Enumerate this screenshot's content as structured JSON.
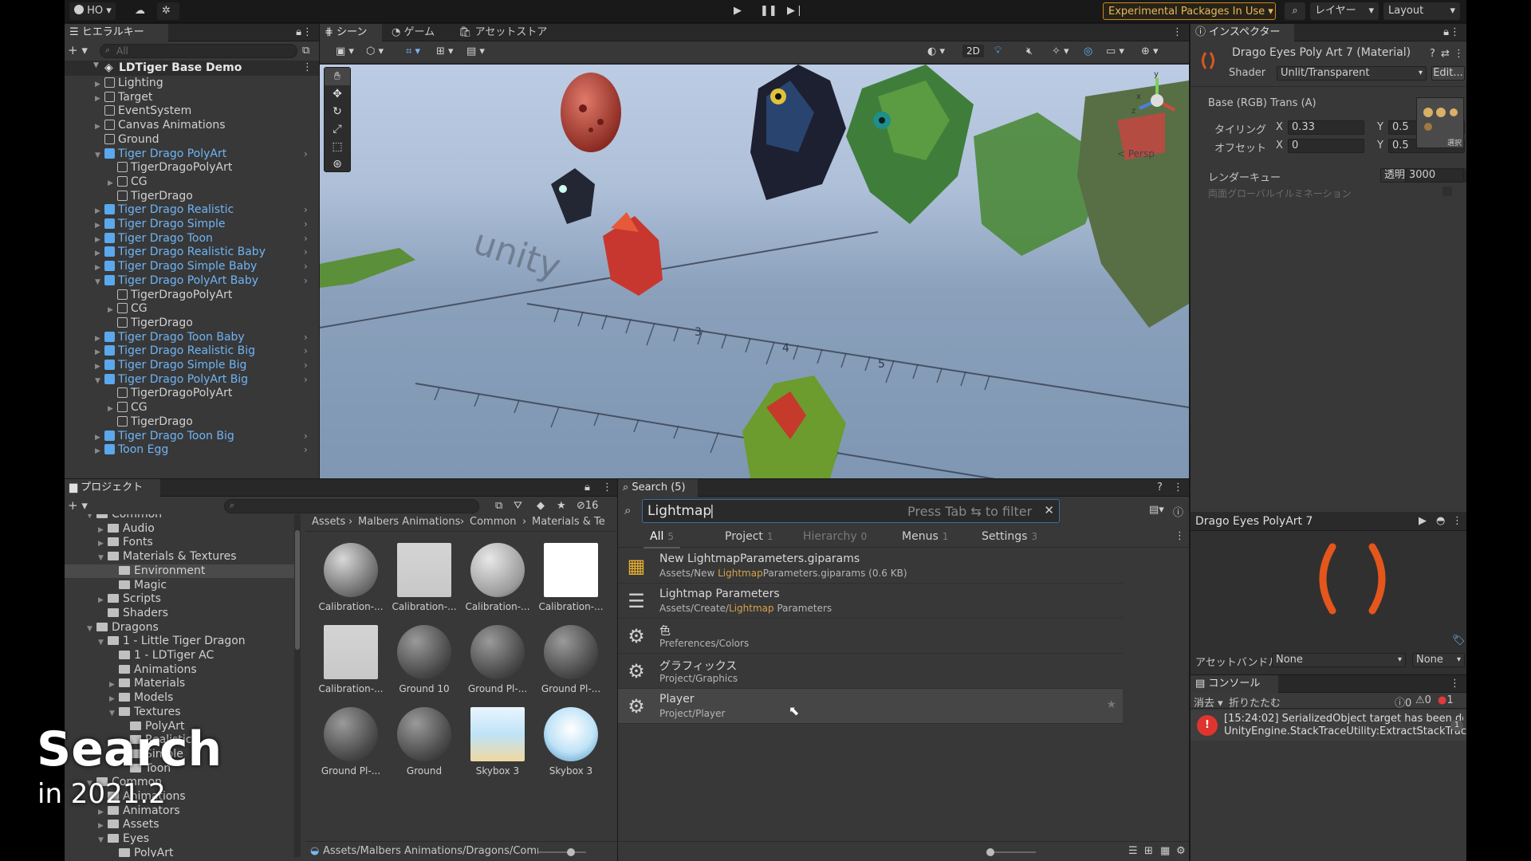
{
  "toolbar": {
    "account": "HO",
    "experimental": "Experimental Packages In Use",
    "layers": "レイヤー",
    "layout": "Layout"
  },
  "hierarchy": {
    "tab": "ヒエラルキー",
    "search_placeholder": "All",
    "scene": "LDTiger Base Demo",
    "items": [
      {
        "label": "Lighting",
        "indent": 1,
        "prefab": false,
        "arrow": "▶"
      },
      {
        "label": "Target",
        "indent": 1,
        "prefab": false,
        "arrow": "▶"
      },
      {
        "label": "EventSystem",
        "indent": 1,
        "prefab": false,
        "arrow": ""
      },
      {
        "label": "Canvas Animations",
        "indent": 1,
        "prefab": false,
        "arrow": "▶"
      },
      {
        "label": "Ground",
        "indent": 1,
        "prefab": false,
        "arrow": ""
      },
      {
        "label": "Tiger Drago PolyArt",
        "indent": 1,
        "prefab": true,
        "arrow": "▼"
      },
      {
        "label": "TigerDragoPolyArt",
        "indent": 2,
        "prefab": false,
        "arrow": ""
      },
      {
        "label": "CG",
        "indent": 2,
        "prefab": false,
        "arrow": "▶"
      },
      {
        "label": "TigerDrago",
        "indent": 2,
        "prefab": false,
        "arrow": ""
      },
      {
        "label": "Tiger Drago Realistic",
        "indent": 1,
        "prefab": true,
        "arrow": "▶"
      },
      {
        "label": "Tiger Drago Simple",
        "indent": 1,
        "prefab": true,
        "arrow": "▶"
      },
      {
        "label": "Tiger Drago Toon",
        "indent": 1,
        "prefab": true,
        "arrow": "▶"
      },
      {
        "label": "Tiger Drago Realistic Baby",
        "indent": 1,
        "prefab": true,
        "arrow": "▶"
      },
      {
        "label": "Tiger Drago Simple Baby",
        "indent": 1,
        "prefab": true,
        "arrow": "▶"
      },
      {
        "label": "Tiger Drago PolyArt Baby",
        "indent": 1,
        "prefab": true,
        "arrow": "▼"
      },
      {
        "label": "TigerDragoPolyArt",
        "indent": 2,
        "prefab": false,
        "arrow": ""
      },
      {
        "label": "CG",
        "indent": 2,
        "prefab": false,
        "arrow": "▶"
      },
      {
        "label": "TigerDrago",
        "indent": 2,
        "prefab": false,
        "arrow": ""
      },
      {
        "label": "Tiger Drago Toon Baby",
        "indent": 1,
        "prefab": true,
        "arrow": "▶"
      },
      {
        "label": "Tiger Drago Realistic Big",
        "indent": 1,
        "prefab": true,
        "arrow": "▶"
      },
      {
        "label": "Tiger Drago Simple Big",
        "indent": 1,
        "prefab": true,
        "arrow": "▶"
      },
      {
        "label": "Tiger Drago PolyArt Big",
        "indent": 1,
        "prefab": true,
        "arrow": "▼"
      },
      {
        "label": "TigerDragoPolyArt",
        "indent": 2,
        "prefab": false,
        "arrow": ""
      },
      {
        "label": "CG",
        "indent": 2,
        "prefab": false,
        "arrow": "▶"
      },
      {
        "label": "TigerDrago",
        "indent": 2,
        "prefab": false,
        "arrow": ""
      },
      {
        "label": "Tiger Drago Toon Big",
        "indent": 1,
        "prefab": true,
        "arrow": "▶"
      },
      {
        "label": "Toon Egg",
        "indent": 1,
        "prefab": true,
        "arrow": "▶"
      }
    ]
  },
  "scene": {
    "tabs": [
      "シーン",
      "ゲーム",
      "アセットストア"
    ],
    "mode_2d": "2D",
    "persp": "< Persp"
  },
  "inspector": {
    "tab": "インスペクター",
    "title": "Drago Eyes Poly Art 7 (Material)",
    "shader_label": "Shader",
    "shader_value": "Unlit/Transparent",
    "edit": "Edit...",
    "base_label": "Base (RGB) Trans (A)",
    "tiling_label": "タイリング",
    "offset_label": "オフセット",
    "tiling_x": "0.33",
    "tiling_y": "0.5",
    "offset_x": "0",
    "offset_y": "0.5",
    "select": "選択",
    "render_queue_label": "レンダーキュー",
    "render_queue_mode": "透明",
    "render_queue_value": "3000",
    "gi_label": "両面グローバルイルミネーション",
    "preview_title": "Drago Eyes PolyArt 7",
    "asset_bundle_label": "アセットバンドル",
    "asset_bundle_value": "None",
    "asset_variant_value": "None"
  },
  "console": {
    "tab": "コンソール",
    "clear": "消去",
    "collapse": "折りたたむ",
    "count_info": "0",
    "count_warn": "0",
    "count_error": "1",
    "message_line1": "[15:24:02] SerializedObject target has been destroyed.",
    "message_line2": "UnityEngine.StackTraceUtility:ExtractStackTrace ()",
    "badge": "1"
  },
  "project": {
    "tab": "プロジェクト",
    "hidden_count": "16",
    "breadcrumb": [
      "Assets",
      "Malbers Animations",
      "Common",
      "Materials & Te"
    ],
    "path": "Assets/Malbers Animations/Dragons/Comm",
    "tree": [
      {
        "label": "Common",
        "indent": 2,
        "arrow": "▼"
      },
      {
        "label": "Audio",
        "indent": 3,
        "arrow": "▶"
      },
      {
        "label": "Fonts",
        "indent": 3,
        "arrow": "▶"
      },
      {
        "label": "Materials & Textures",
        "indent": 3,
        "arrow": "▼"
      },
      {
        "label": "Environment",
        "indent": 4,
        "arrow": "",
        "selected": true
      },
      {
        "label": "Magic",
        "indent": 4,
        "arrow": ""
      },
      {
        "label": "Scripts",
        "indent": 3,
        "arrow": "▶"
      },
      {
        "label": "Shaders",
        "indent": 3,
        "arrow": ""
      },
      {
        "label": "Dragons",
        "indent": 2,
        "arrow": "▼"
      },
      {
        "label": "1 - Little Tiger Dragon",
        "indent": 3,
        "arrow": "▼"
      },
      {
        "label": "1 - LDTiger AC",
        "indent": 4,
        "arrow": ""
      },
      {
        "label": "Animations",
        "indent": 4,
        "arrow": ""
      },
      {
        "label": "Materials",
        "indent": 4,
        "arrow": "▶"
      },
      {
        "label": "Models",
        "indent": 4,
        "arrow": "▶"
      },
      {
        "label": "Textures",
        "indent": 4,
        "arrow": "▼"
      },
      {
        "label": "PolyArt",
        "indent": 5,
        "arrow": ""
      },
      {
        "label": "Realistic",
        "indent": 5,
        "arrow": ""
      },
      {
        "label": "Simple",
        "indent": 5,
        "arrow": ""
      },
      {
        "label": "Toon",
        "indent": 5,
        "arrow": ""
      },
      {
        "label": "Common",
        "indent": 2,
        "arrow": "▼"
      },
      {
        "label": "Animations",
        "indent": 3,
        "arrow": ""
      },
      {
        "label": "Animators",
        "indent": 3,
        "arrow": "▶"
      },
      {
        "label": "Assets",
        "indent": 3,
        "arrow": "▶"
      },
      {
        "label": "Eyes",
        "indent": 3,
        "arrow": "▼"
      },
      {
        "label": "PolyArt",
        "indent": 4,
        "arrow": ""
      }
    ],
    "assets": [
      {
        "label": "Calibration-...",
        "style": "sphere-gray"
      },
      {
        "label": "Calibration-...",
        "style": "flat-light"
      },
      {
        "label": "Calibration-...",
        "style": "sphere-light"
      },
      {
        "label": "Calibration-...",
        "style": "white"
      },
      {
        "label": "Calibration-...",
        "style": "flat-light"
      },
      {
        "label": "Ground 10",
        "style": "sphere-dark"
      },
      {
        "label": "Ground Pl-...",
        "style": "sphere-dark"
      },
      {
        "label": "Ground Pl-...",
        "style": "sphere-dark"
      },
      {
        "label": "Ground Pl-...",
        "style": "sphere-dark"
      },
      {
        "label": "Ground",
        "style": "sphere-dark"
      },
      {
        "label": "Skybox 3",
        "style": "sky"
      },
      {
        "label": "Skybox 3",
        "style": "sky-sphere"
      }
    ]
  },
  "search": {
    "tab": "Search (5)",
    "query": "Lightmap",
    "hint": "Press Tab ⇆ to filter",
    "filters": [
      {
        "label": "All",
        "count": "5",
        "active": true
      },
      {
        "label": "Project",
        "count": "1",
        "active": false
      },
      {
        "label": "Hierarchy",
        "count": "0",
        "active": false,
        "dim": true
      },
      {
        "label": "Menus",
        "count": "1",
        "active": false
      },
      {
        "label": "Settings",
        "count": "3",
        "active": false
      }
    ],
    "results": [
      {
        "pre": "New ",
        "hl": "Lightmap",
        "post": "Parameters.giparams",
        "sub_pre": "Assets/New ",
        "sub_hl": "Lightmap",
        "sub_post": "Parameters.giparams (0.6 KB)",
        "icon": "giparams-icon"
      },
      {
        "pre": "",
        "hl": "",
        "post": "Lightmap Parameters",
        "sub_pre": "Assets/Create/",
        "sub_hl": "Lightmap",
        "sub_post": " Parameters",
        "icon": "menu-icon"
      },
      {
        "pre": "",
        "hl": "",
        "post": "色",
        "sub_pre": "Preferences/Colors",
        "sub_hl": "",
        "sub_post": "",
        "icon": "gear-icon"
      },
      {
        "pre": "",
        "hl": "",
        "post": "グラフィックス",
        "sub_pre": "Project/Graphics",
        "sub_hl": "",
        "sub_post": "",
        "icon": "gear-icon"
      },
      {
        "pre": "",
        "hl": "",
        "post": "Player",
        "sub_pre": "Project/Player",
        "sub_hl": "",
        "sub_post": "",
        "icon": "gear-icon"
      }
    ]
  },
  "overlay": {
    "title": "Search",
    "subtitle": "in 2021.2"
  }
}
